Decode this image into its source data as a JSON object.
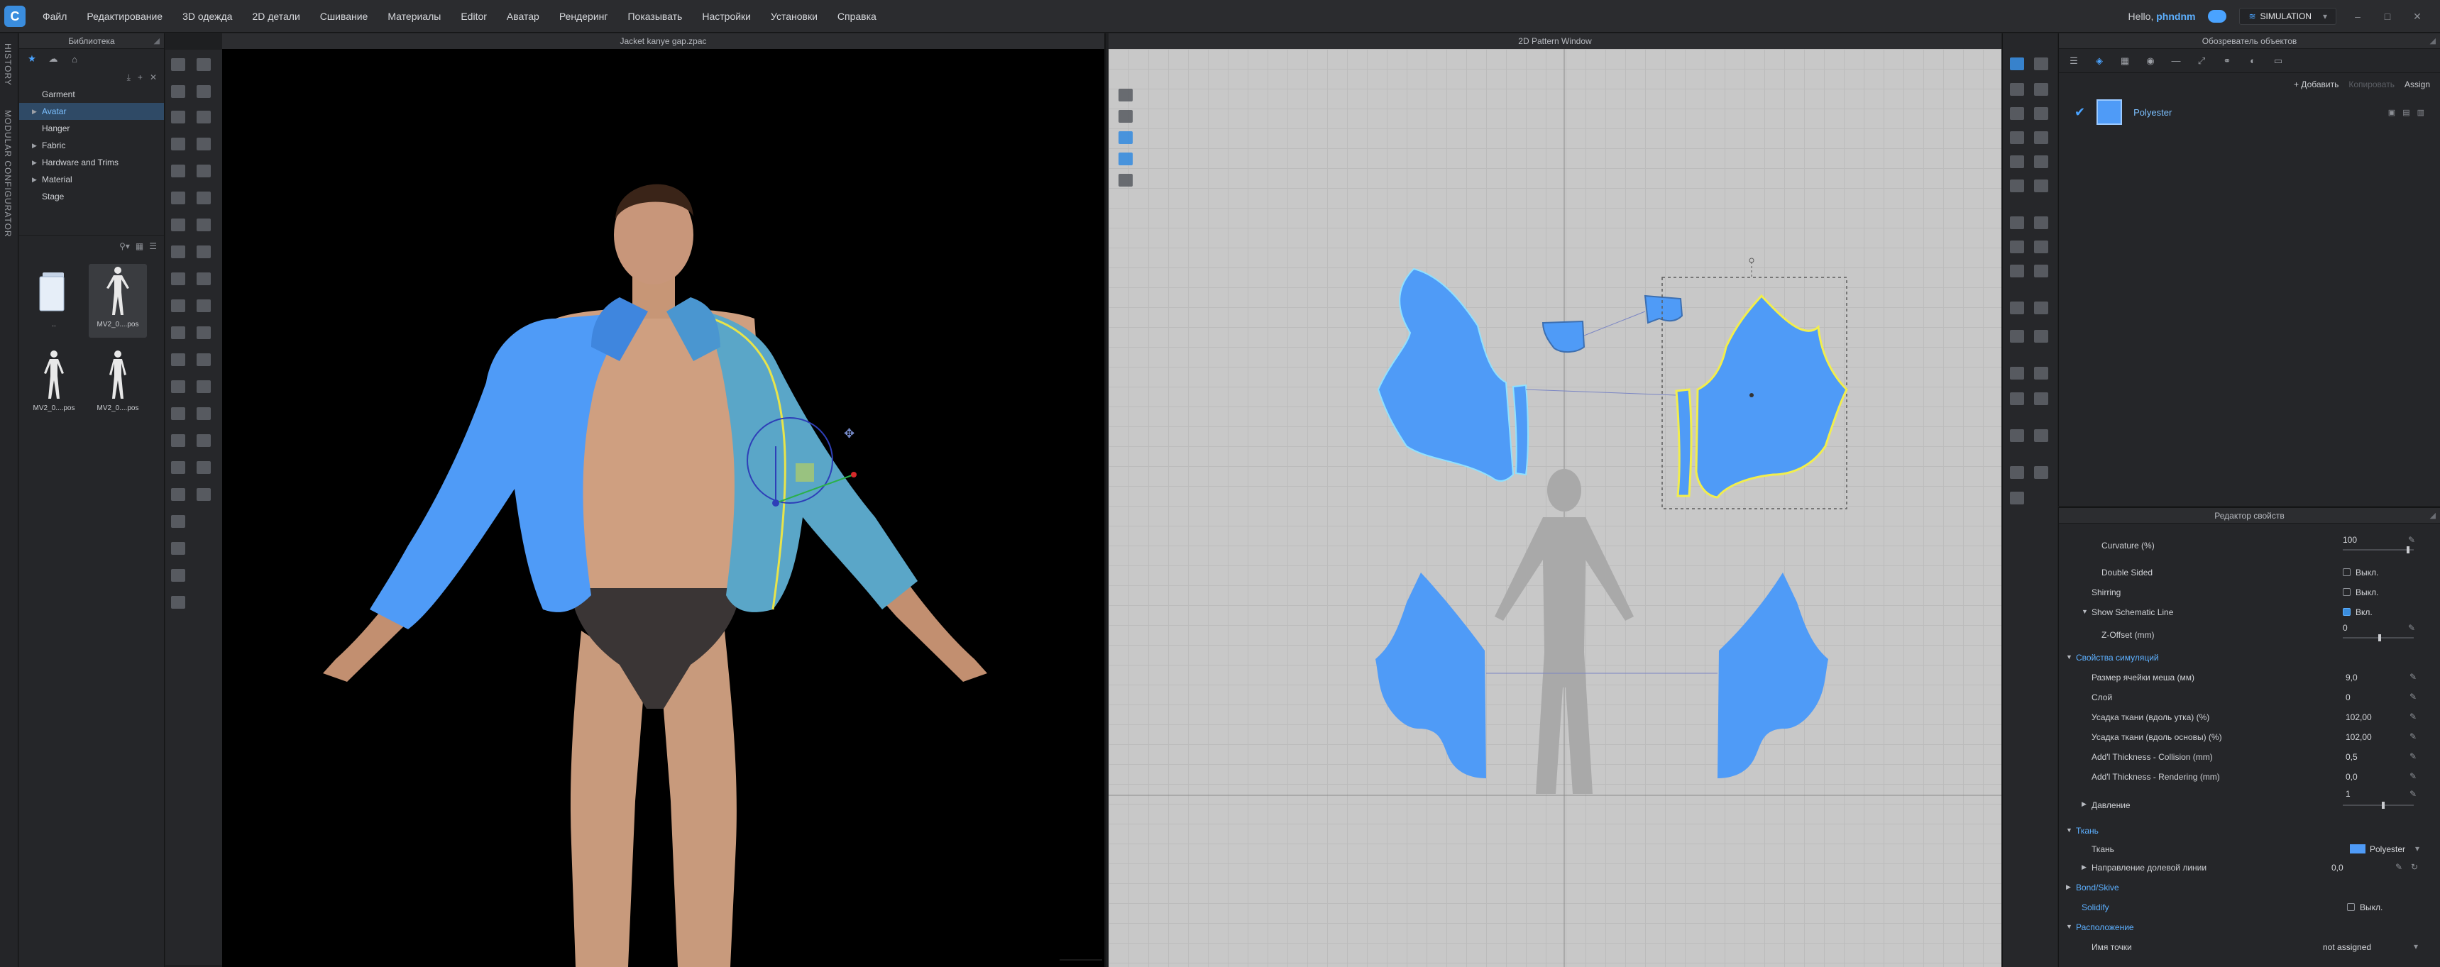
{
  "menu": {
    "logo": "C",
    "items": [
      "Файл",
      "Редактирование",
      "3D одежда",
      "2D детали",
      "Сшивание",
      "Материалы",
      "Editor",
      "Аватар",
      "Рендеринг",
      "Показывать",
      "Настройки",
      "Установки",
      "Справка"
    ],
    "hello": "Hello,",
    "username": "phndnm",
    "mode": "SIMULATION"
  },
  "side_tabs": [
    "HISTORY",
    "MODULAR CONFIGURATOR"
  ],
  "library": {
    "title": "Библиотека",
    "tree": [
      {
        "label": "Garment",
        "arrow": false,
        "selected": false
      },
      {
        "label": "Avatar",
        "arrow": true,
        "selected": true
      },
      {
        "label": "Hanger",
        "arrow": false,
        "selected": false
      },
      {
        "label": "Fabric",
        "arrow": true,
        "selected": false
      },
      {
        "label": "Hardware and Trims",
        "arrow": true,
        "selected": false
      },
      {
        "label": "Material",
        "arrow": true,
        "selected": false
      },
      {
        "label": "Stage",
        "arrow": false,
        "selected": false
      }
    ],
    "thumbs": [
      "..",
      "MV2_0....pos",
      "MV2_0....pos",
      "MV2_0....pos"
    ]
  },
  "viewport3d": {
    "title": "Jacket kanye gap.zpac"
  },
  "pattern2d": {
    "title": "2D Pattern Window"
  },
  "object_browser": {
    "title": "Обозреватель объектов",
    "add": "+ Добавить",
    "copy": "Копировать",
    "assign": "Assign",
    "fabric_name": "Polyester"
  },
  "property_editor": {
    "title": "Редактор свойств",
    "curvature_label": "Curvature (%)",
    "curvature_value": "100",
    "curvature_pct": 0.9,
    "double_sided_label": "Double Sided",
    "double_sided_value": "Выкл.",
    "shirring_label": "Shirring",
    "shirring_value": "Выкл.",
    "schematic_label": "Show Schematic Line",
    "schematic_value": "Вкл.",
    "zoffset_label": "Z-Offset (mm)",
    "zoffset_value": "0",
    "zoffset_pct": 0.5,
    "sim_section": "Свойства симуляций",
    "mesh_label": "Размер ячейки меша (мм)",
    "mesh_value": "9,0",
    "layer_label": "Слой",
    "layer_value": "0",
    "weft_label": "Усадка ткани (вдоль утка) (%)",
    "weft_value": "102,00",
    "warp_label": "Усадка ткани (вдоль основы) (%)",
    "warp_value": "102,00",
    "collision_label": "Add'l Thickness - Collision (mm)",
    "collision_value": "0,5",
    "rendering_label": "Add'l Thickness - Rendering (mm)",
    "rendering_value": "0,0",
    "pressure_label": "Давление",
    "pressure_value": "1",
    "pressure_pct": 0.55,
    "fabric_section": "Ткань",
    "fabric_label": "Ткань",
    "fabric_value": "Polyester",
    "grain_label": "Направление долевой линии",
    "grain_value": "0,0",
    "bond_section": "Bond/Skive",
    "solidify_label": "Solidify",
    "solidify_value": "Выкл.",
    "placement_section": "Расположение",
    "point_label": "Имя точки",
    "point_value": "not assigned"
  },
  "colors": {
    "accent": "#3a8dde",
    "garment": "#4f9bf7",
    "panel": "#252629",
    "selection": "#f2ee4d"
  }
}
